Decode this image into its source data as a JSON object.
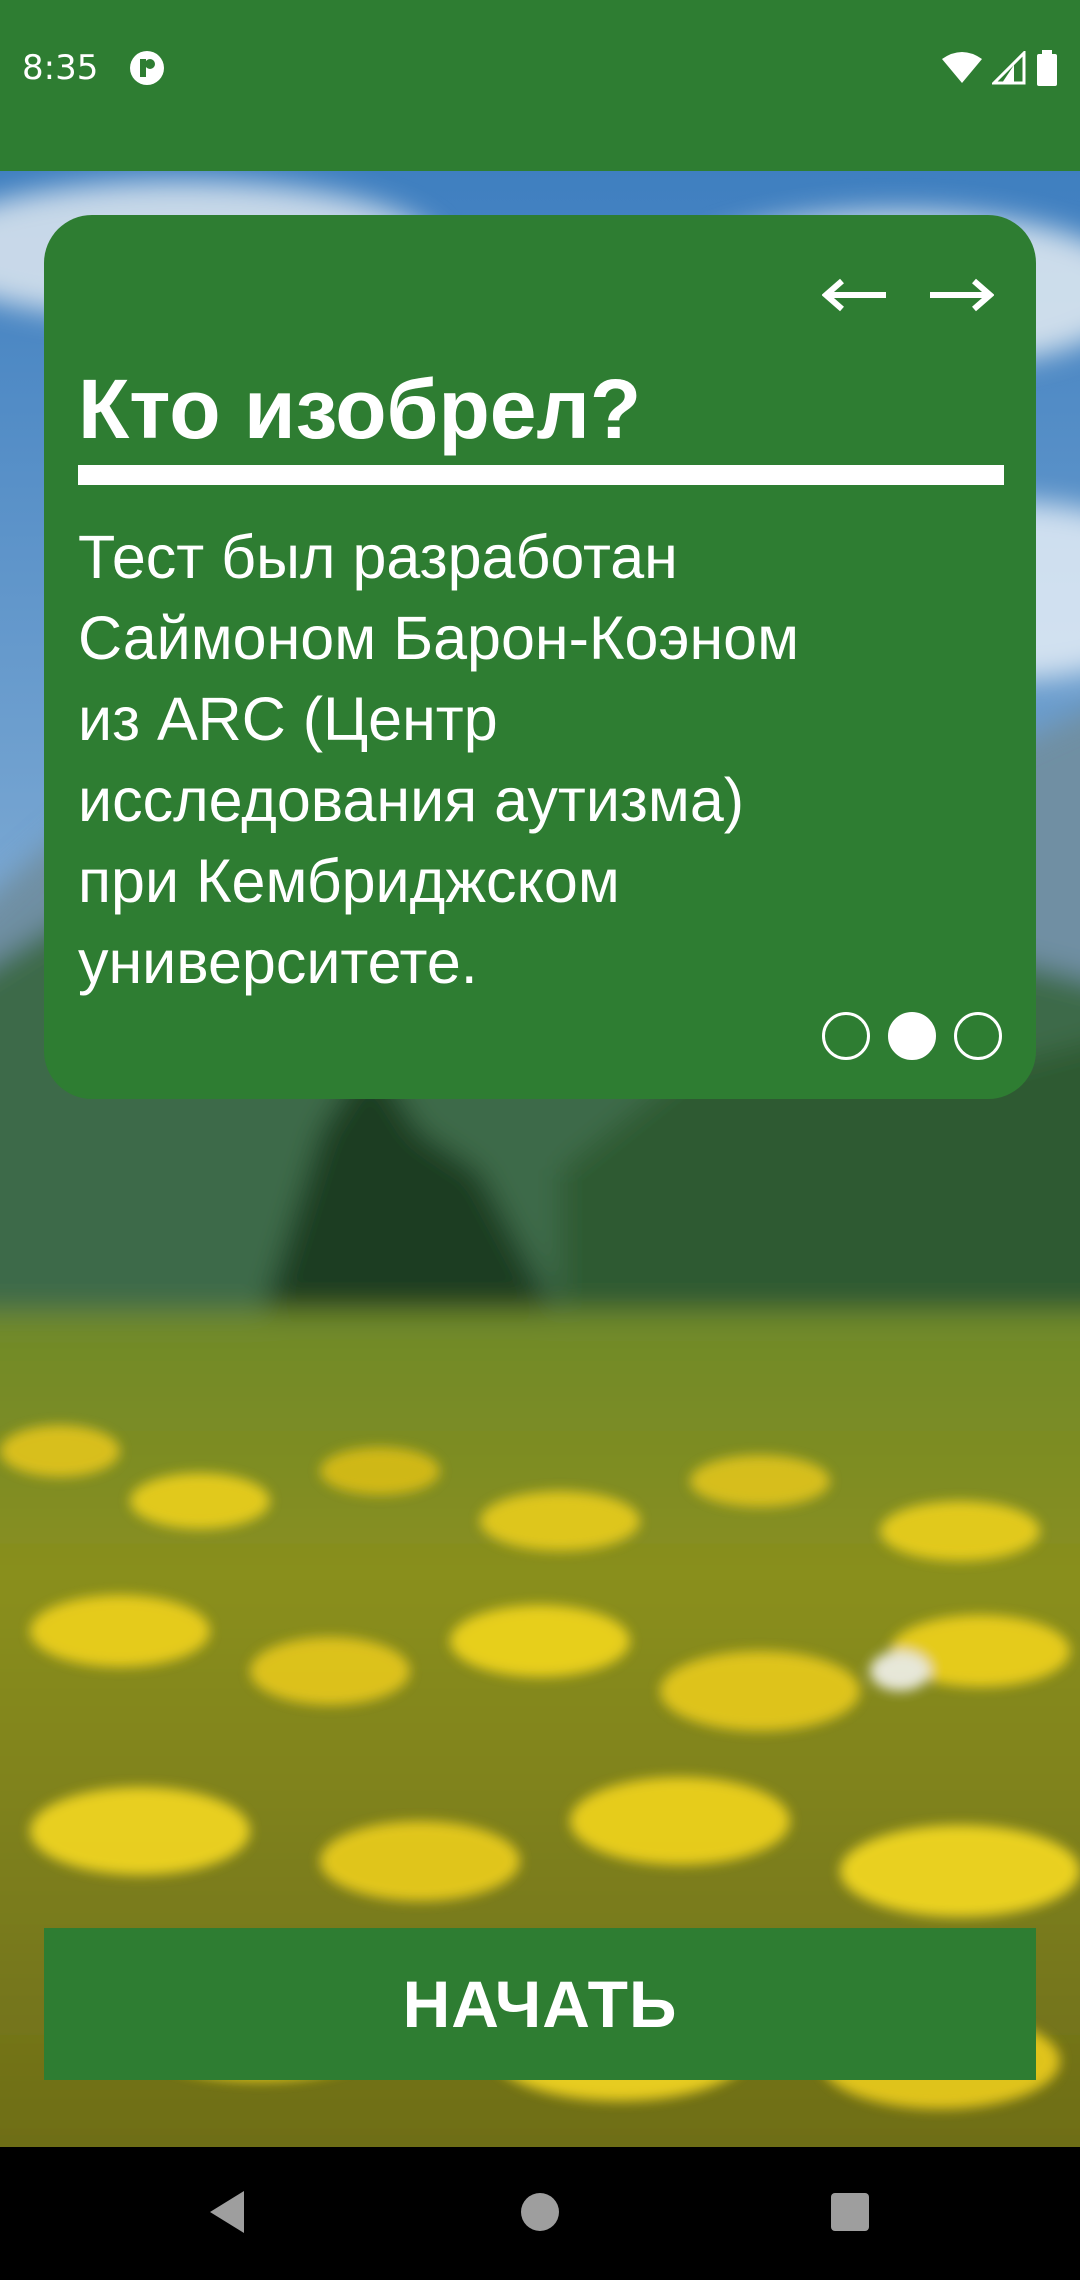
{
  "status_bar": {
    "time": "8:35"
  },
  "card": {
    "title": "Кто изобрел?",
    "body_lines": [
      "Тест был разработан",
      "Саймоном Барон-Коэном",
      "из ARC (Центр",
      "исследования аутизма)",
      "при Кембриджском",
      "университете."
    ],
    "page_count": 3,
    "active_page": 2
  },
  "start_button": {
    "label": "НАЧАТЬ"
  },
  "colors": {
    "primary_green": "#2e7d32",
    "text": "#ffffff"
  },
  "icons": {
    "status": [
      "app-notification-icon",
      "wifi-icon",
      "cellular-signal-icon",
      "battery-icon"
    ],
    "card_nav": [
      "arrow-left-icon",
      "arrow-right-icon"
    ],
    "system_nav": [
      "back-icon",
      "home-icon",
      "recents-icon"
    ]
  }
}
